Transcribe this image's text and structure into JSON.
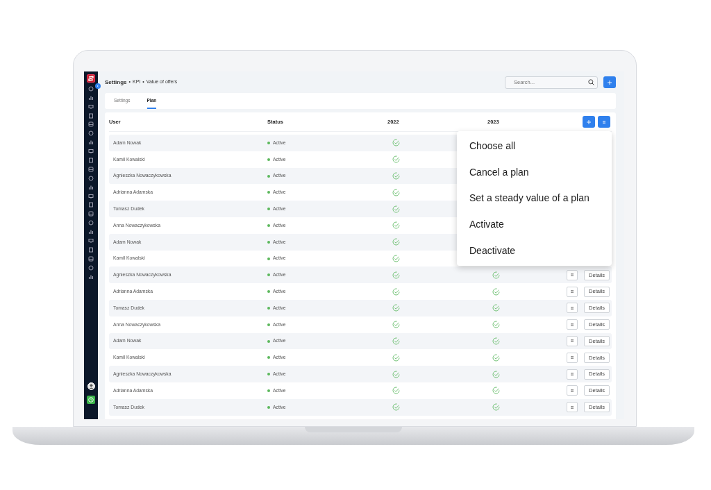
{
  "breadcrumb": {
    "separator": "•",
    "items": [
      {
        "label": "Settings"
      },
      {
        "label": "KPI"
      },
      {
        "label": "Value of offers"
      }
    ]
  },
  "search": {
    "placeholder": "Search..."
  },
  "tabs": [
    {
      "label": "Settings",
      "selected": false
    },
    {
      "label": "Plan",
      "selected": true
    }
  ],
  "table": {
    "columns": [
      "User",
      "Status",
      "2022",
      "2023"
    ],
    "rows": [
      {
        "user": "Adam Nowak",
        "status": "Active",
        "plan_2022": true
      },
      {
        "user": "Kamil Kowalski",
        "status": "Active",
        "plan_2022": true
      },
      {
        "user": "Agnieszka Nowaczykowska",
        "status": "Active",
        "plan_2022": true
      },
      {
        "user": "Adrianna Adamska",
        "status": "Active",
        "plan_2022": true
      },
      {
        "user": "Tomasz Dudek",
        "status": "Active",
        "plan_2022": true
      },
      {
        "user": "Anna Nowaczykowska",
        "status": "Active",
        "plan_2022": true
      },
      {
        "user": "Adam Nowak",
        "status": "Active",
        "plan_2022": true
      },
      {
        "user": "Kamil Kowalski",
        "status": "Active",
        "plan_2022": true
      },
      {
        "user": "Agnieszka Nowaczykowska",
        "status": "Active",
        "plan_2022": true,
        "plan_2023": true,
        "details": "Details"
      },
      {
        "user": "Adrianna Adamska",
        "status": "Active",
        "plan_2022": true,
        "plan_2023": true,
        "details": "Details"
      },
      {
        "user": "Tomasz Dudek",
        "status": "Active",
        "plan_2022": true,
        "plan_2023": true,
        "details": "Details"
      },
      {
        "user": "Anna Nowaczykowska",
        "status": "Active",
        "plan_2022": true,
        "plan_2023": true,
        "details": "Details"
      },
      {
        "user": "Adam Nowak",
        "status": "Active",
        "plan_2022": true,
        "plan_2023": true,
        "details": "Details"
      },
      {
        "user": "Kamil Kowalski",
        "status": "Active",
        "plan_2022": true,
        "plan_2023": true,
        "details": "Details"
      },
      {
        "user": "Agnieszka Nowaczykowska",
        "status": "Active",
        "plan_2022": true,
        "plan_2023": true,
        "details": "Details"
      },
      {
        "user": "Adrianna Adamska",
        "status": "Active",
        "plan_2022": true,
        "plan_2023": true,
        "details": "Details"
      },
      {
        "user": "Tomasz Dudek",
        "status": "Active",
        "plan_2022": true,
        "plan_2023": true,
        "details": "Details"
      }
    ]
  },
  "dropdown": {
    "items": [
      "Choose all",
      "Cancel a plan",
      "Set a steady value of a plan",
      "Activate",
      "Deactivate"
    ]
  }
}
